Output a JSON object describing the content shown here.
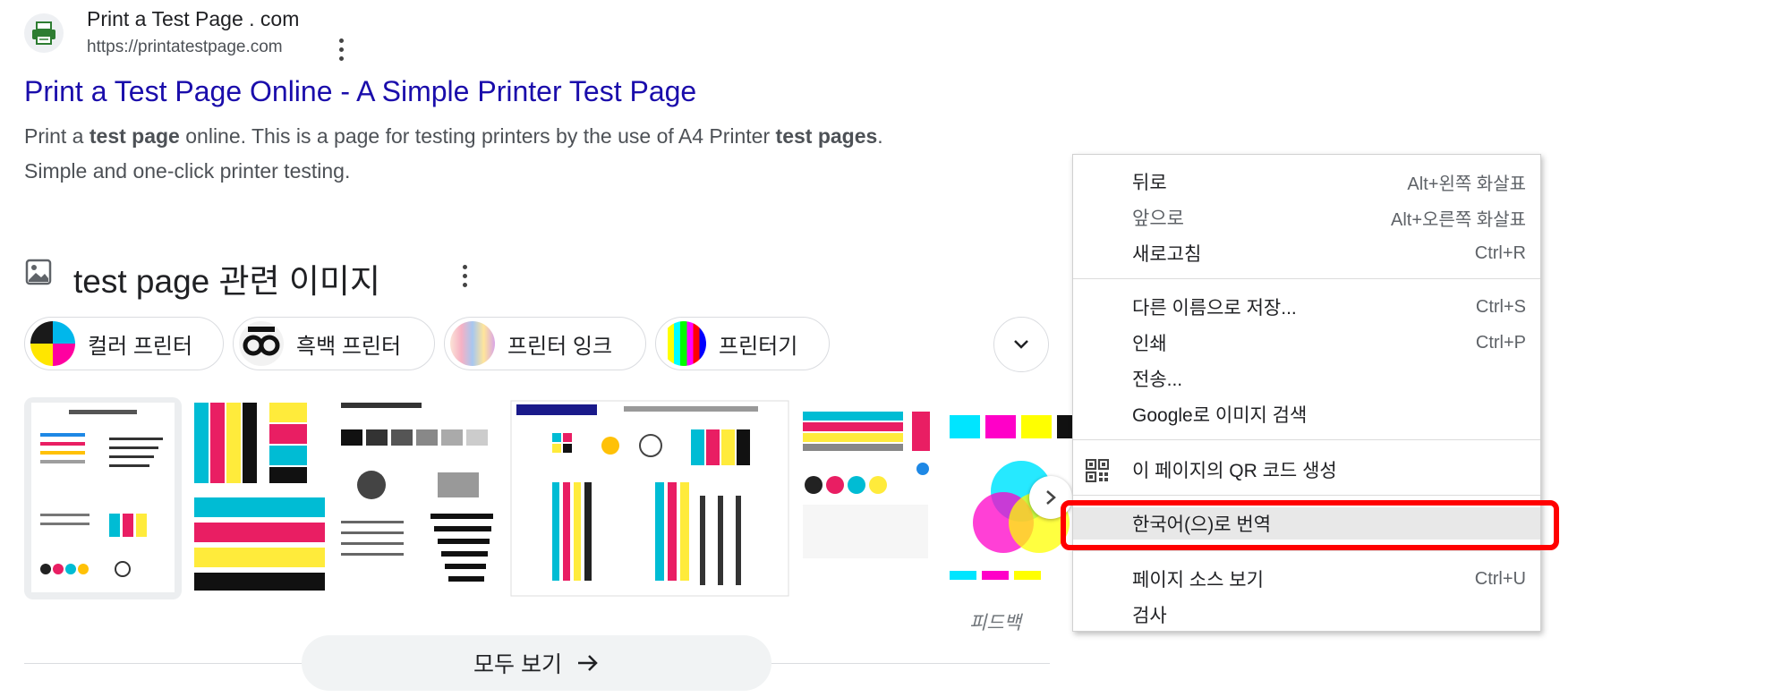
{
  "result": {
    "site_name": "Print a Test Page . com",
    "site_url": "https://printatestpage.com",
    "title": "Print a Test Page Online - A Simple Printer Test Page",
    "snippet_line1_parts": [
      "Print a ",
      "test page",
      " online. This is a page for testing printers by the use of A4 Printer ",
      "test pages",
      "."
    ],
    "snippet_line2": "Simple and one-click printer testing."
  },
  "images": {
    "header_title": "test page 관련 이미지",
    "chips": [
      {
        "label": "컬러 프린터"
      },
      {
        "label": "흑백 프린터"
      },
      {
        "label": "프린터 잉크"
      },
      {
        "label": "프린터기"
      }
    ],
    "feedback": "피드백",
    "see_all": "모두 보기"
  },
  "context_menu": {
    "items": [
      {
        "label": "뒤로",
        "shortcut": "Alt+왼쪽 화살표"
      },
      {
        "label": "앞으로",
        "shortcut": "Alt+오른쪽 화살표"
      },
      {
        "label": "새로고침",
        "shortcut": "Ctrl+R"
      },
      {
        "label": "다른 이름으로 저장...",
        "shortcut": "Ctrl+S"
      },
      {
        "label": "인쇄",
        "shortcut": "Ctrl+P"
      },
      {
        "label": "전송..."
      },
      {
        "label": "Google로 이미지 검색"
      },
      {
        "label": "이 페이지의 QR 코드 생성"
      },
      {
        "label": "한국어(으)로 번역"
      },
      {
        "label": "페이지 소스 보기",
        "shortcut": "Ctrl+U"
      },
      {
        "label": "검사"
      }
    ]
  },
  "colors": {
    "link": "#1a0dab",
    "highlight_box": "#ff0000",
    "menu_highlight": "#e8e8e8"
  }
}
